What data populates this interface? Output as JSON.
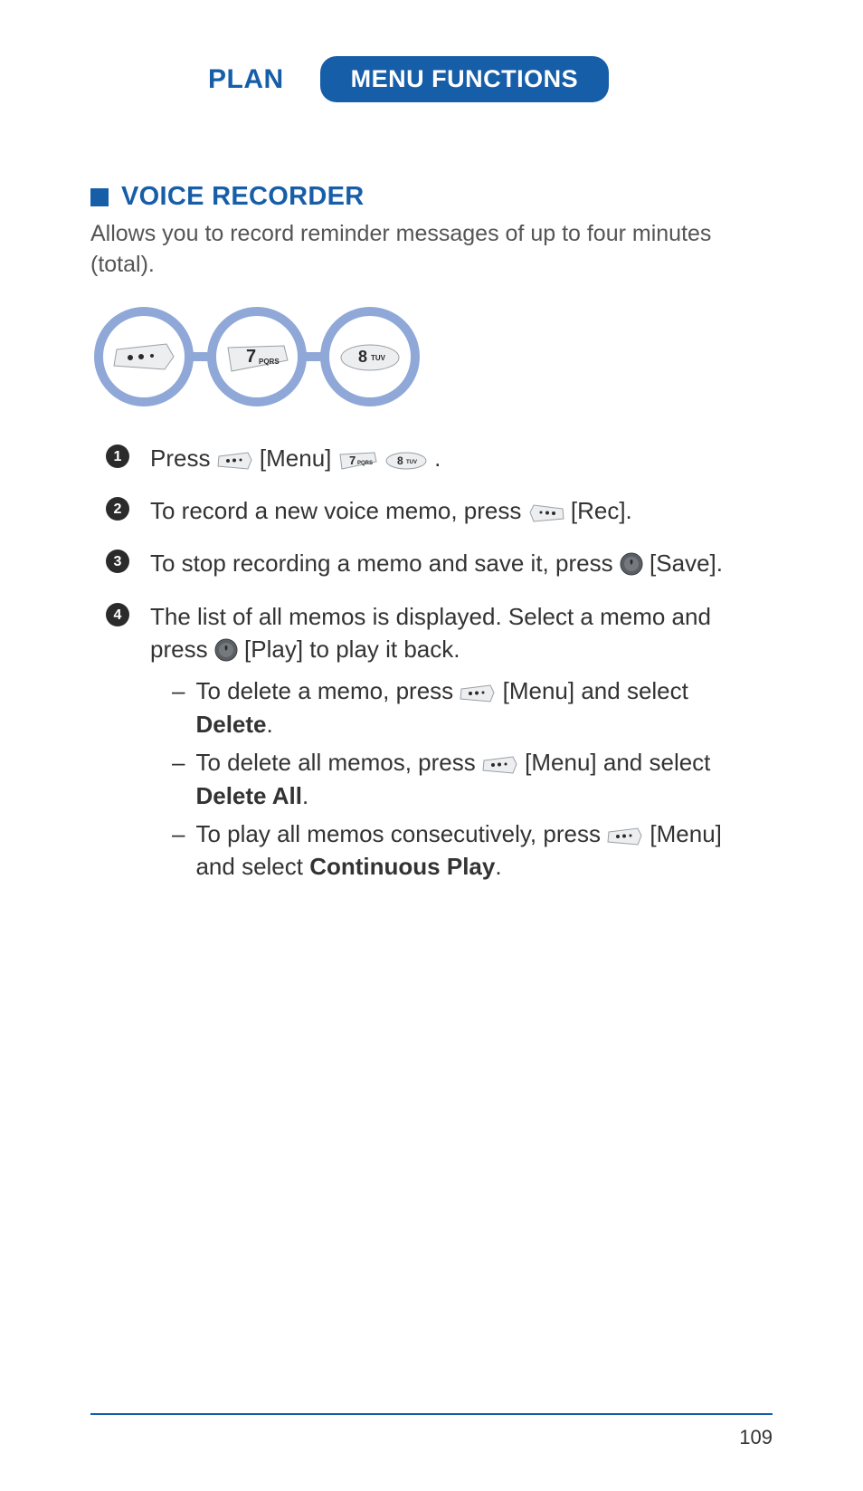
{
  "header": {
    "plan": "PLAN",
    "tab": "MENU FUNCTIONS"
  },
  "section": {
    "title": "VOICE RECORDER",
    "intro": "Allows you to record reminder messages of up to four minutes (total)."
  },
  "keychain": {
    "key1": "menu-key",
    "key2_digit": "7",
    "key2_sub": "PQRS",
    "key3_digit": "8",
    "key3_sub": "TUV"
  },
  "steps": {
    "s1": {
      "pre": "Press ",
      "menu_label": " [Menu] ",
      "end": "."
    },
    "s2": {
      "pre": "To record a new voice memo, press ",
      "rec_label": " [Rec]."
    },
    "s3": {
      "pre": "To stop recording a memo and save it, press ",
      "save_label": "[Save]."
    },
    "s4": {
      "line1_pre": "The list of all memos is displayed. Select a memo and press ",
      "line1_play": " [Play] to play it back.",
      "sub1_pre": "To delete a memo, press ",
      "sub1_post": " [Menu] and select ",
      "sub1_bold": "Delete",
      "sub1_end": ".",
      "sub2_pre": "To delete all memos, press ",
      "sub2_post": " [Menu] and select ",
      "sub2_bold": "Delete All",
      "sub2_end": ".",
      "sub3_pre": "To play all memos consecutively, press ",
      "sub3_post": " [Menu] and select ",
      "sub3_bold": "Continuous Play",
      "sub3_end": "."
    }
  },
  "dash": "–",
  "page_number": "109"
}
